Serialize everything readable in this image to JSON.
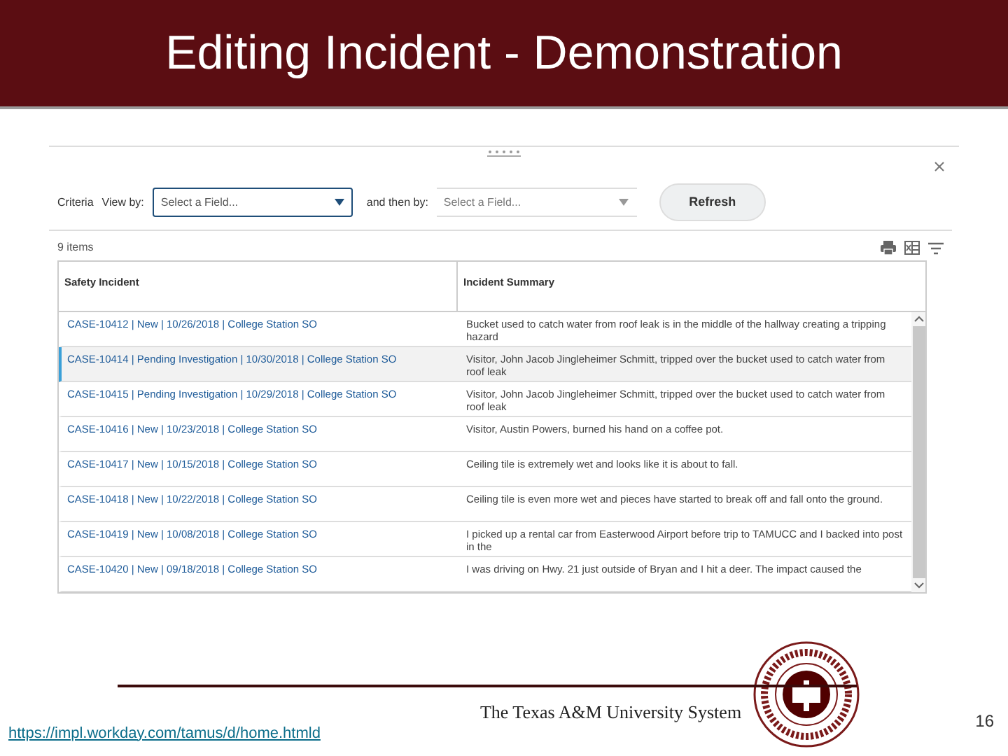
{
  "slide_title": "Editing Incident - Demonstration",
  "panel": {
    "criteria_label": "Criteria",
    "view_by_label": "View by:",
    "view_by_field": {
      "placeholder": "Select a Field..."
    },
    "then_by_label": "and then by:",
    "then_by_field": {
      "placeholder": "Select a Field..."
    },
    "refresh_button": "Refresh",
    "item_count": "9 items"
  },
  "table": {
    "columns": [
      "Safety Incident",
      "Incident Summary"
    ],
    "rows": [
      {
        "incident": "CASE-10412 | New | 10/26/2018 | College Station SO",
        "summary": "Bucket used to catch water from roof leak is in the middle of the hallway creating a tripping hazard",
        "selected": false
      },
      {
        "incident": "CASE-10414 | Pending Investigation | 10/30/2018 | College Station SO",
        "summary": "Visitor, John Jacob Jingleheimer Schmitt, tripped over the bucket used to catch water from roof leak",
        "selected": true
      },
      {
        "incident": "CASE-10415 | Pending Investigation | 10/29/2018 | College Station SO",
        "summary": "Visitor, John Jacob Jingleheimer Schmitt, tripped over the bucket used to catch water from roof leak",
        "selected": false
      },
      {
        "incident": "CASE-10416 | New | 10/23/2018 | College Station SO",
        "summary": "Visitor, Austin Powers, burned his hand on a coffee pot.",
        "selected": false
      },
      {
        "incident": "CASE-10417 | New | 10/15/2018 | College Station SO",
        "summary": "Ceiling tile is extremely wet and looks like it is about to fall.",
        "selected": false
      },
      {
        "incident": "CASE-10418 | New | 10/22/2018 | College Station SO",
        "summary": "Ceiling tile is even more wet and pieces have started to break off and fall onto the ground.",
        "selected": false
      },
      {
        "incident": "CASE-10419 | New | 10/08/2018 | College Station SO",
        "summary": "I picked up a rental car from Easterwood Airport before trip to TAMUCC and I backed into post in the",
        "selected": false
      },
      {
        "incident": "CASE-10420 | New | 09/18/2018 | College Station SO",
        "summary": "I was driving on Hwy. 21 just outside of Bryan and I hit a deer. The impact caused the",
        "selected": false
      }
    ]
  },
  "footer": {
    "link": "https://impl.workday.com/tamus/d/home.htmld",
    "brand": "The Texas A&M University System",
    "page_number": "16"
  }
}
